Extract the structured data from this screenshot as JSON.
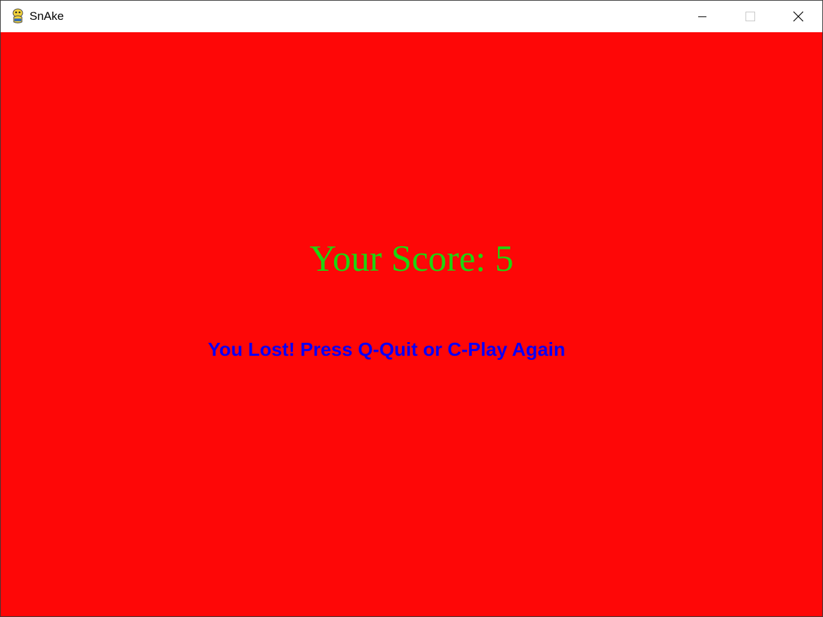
{
  "window": {
    "title": "SnAke",
    "app_icon": "pygame-snake-icon",
    "controls": {
      "minimize_icon": "minimize-icon",
      "maximize_icon": "maximize-icon",
      "close_icon": "close-icon"
    }
  },
  "game": {
    "score_text": "Your Score: 5",
    "score_color": "#1ed50f",
    "message_text": "You Lost! Press Q-Quit or C-Play Again",
    "message_color": "#0b00f4",
    "background_color": "#fe0707"
  }
}
